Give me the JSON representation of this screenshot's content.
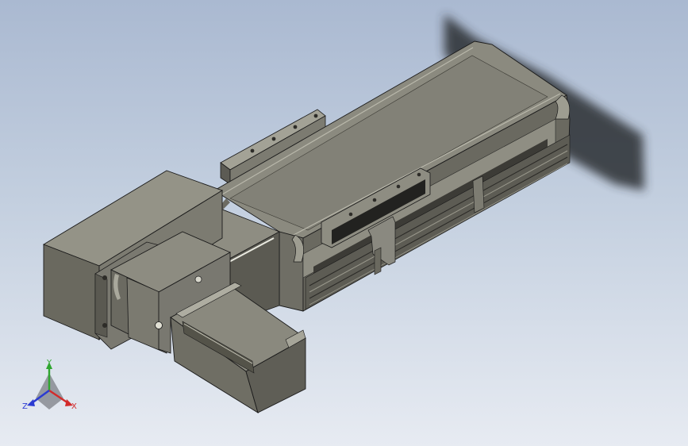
{
  "viewport": {
    "background_top": "#aab9d1",
    "background_bottom": "#e7ebf2"
  },
  "model": {
    "body_color": "#8b8a7f",
    "dark_color": "#4a4943",
    "light_color": "#a3a296",
    "shadow_color": "#2a2d32"
  },
  "triad": {
    "x_label": "X",
    "y_label": "Y",
    "z_label": "Z",
    "x_color": "#d22b2b",
    "y_color": "#2fa62f",
    "z_color": "#2b3bd2"
  }
}
